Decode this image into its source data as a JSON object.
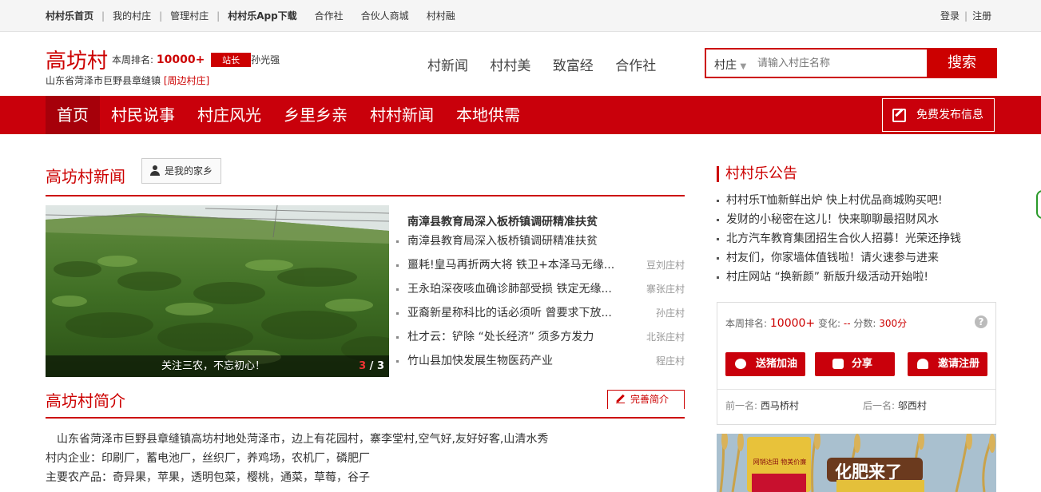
{
  "topbar": {
    "links": [
      "村村乐首页",
      "我的村庄",
      "管理村庄",
      "村村乐App下载",
      "合作社",
      "合伙人商城",
      "村村融"
    ],
    "login": "登录",
    "register": "注册"
  },
  "header": {
    "village_name": "高坊村",
    "rank_label": "本周排名:",
    "rank_value": "10000+",
    "role_badge": "站长",
    "manager_name": "孙光强",
    "address": "山东省菏泽市巨野县章缝镇",
    "nearby_link": "[周边村庄]",
    "nav": [
      "村新闻",
      "村村美",
      "致富经",
      "合作社"
    ],
    "search": {
      "select_value": "村庄",
      "placeholder": "请输入村庄名称",
      "button": "搜索"
    }
  },
  "main_nav": {
    "items": [
      "首页",
      "村民说事",
      "村庄风光",
      "乡里乡亲",
      "村村新闻",
      "本地供需"
    ],
    "active_index": 0,
    "post_button": "免费发布信息"
  },
  "news_section": {
    "title": "高坊村新闻",
    "hometown_button": "是我的家乡",
    "slide_caption": "关注三农，不忘初心！",
    "slide_current": "3",
    "slide_total": "/ 3",
    "headline": "南漳县教育局深入板桥镇调研精准扶贫",
    "items": [
      {
        "title": "南漳县教育局深入板桥镇调研精准扶贫",
        "village": ""
      },
      {
        "title": "噩耗!皇马再折两大将 铁卫+本泽马无缘...",
        "village": "豆刘庄村"
      },
      {
        "title": "王永珀深夜咳血确诊肺部受损 铁定无缘...",
        "village": "寨张庄村"
      },
      {
        "title": "亚裔新星称科比的话必须听 曾要求下放...",
        "village": "孙庄村"
      },
      {
        "title": "杜才云：铲除 “处长经济” 须多方发力",
        "village": "北张庄村"
      },
      {
        "title": "竹山县加快发展生物医药产业",
        "village": "程庄村"
      }
    ]
  },
  "intro_section": {
    "title": "高坊村简介",
    "edit_button": "完善简介",
    "lines": [
      "山东省菏泽市巨野县章缝镇高坊村地处菏泽市，边上有花园村，寨李堂村,空气好,友好好客,山清水秀",
      "村内企业：印刷厂，蓄电池厂，丝织厂，养鸡场，农机厂，磷肥厂",
      "主要农产品：奇异果，苹果，透明包菜，樱桃，通菜，草莓，谷子"
    ]
  },
  "announcement": {
    "title": "村村乐公告",
    "items": [
      "村村乐T恤新鲜出炉 快上村优品商城购买吧!",
      "发财的小秘密在这儿！快来聊聊最招财风水",
      "北方汽车教育集团招生合伙人招募！光荣还挣钱",
      "村友们，你家墙体值钱啦！请火速参与进来",
      "村庄网站 “换新颜” 新版升级活动开始啦!"
    ]
  },
  "stats": {
    "rank_label": "本周排名:",
    "rank_value": "10000+",
    "change_label": "变化:",
    "change_value": "--",
    "score_label": "分数:",
    "score_value": "300分",
    "help": "?",
    "buttons": [
      "送猪加油",
      "分享",
      "邀请注册"
    ],
    "prev_label": "前一名:",
    "prev_name": "西马桥村",
    "next_label": "后一名:",
    "next_name": "邬西村"
  },
  "ad": {
    "bag_text": "网销达田 物美价廉",
    "headline": "化肥来了"
  },
  "colors": {
    "brand_red": "#c9000b",
    "accent_red": "#cc0000"
  }
}
